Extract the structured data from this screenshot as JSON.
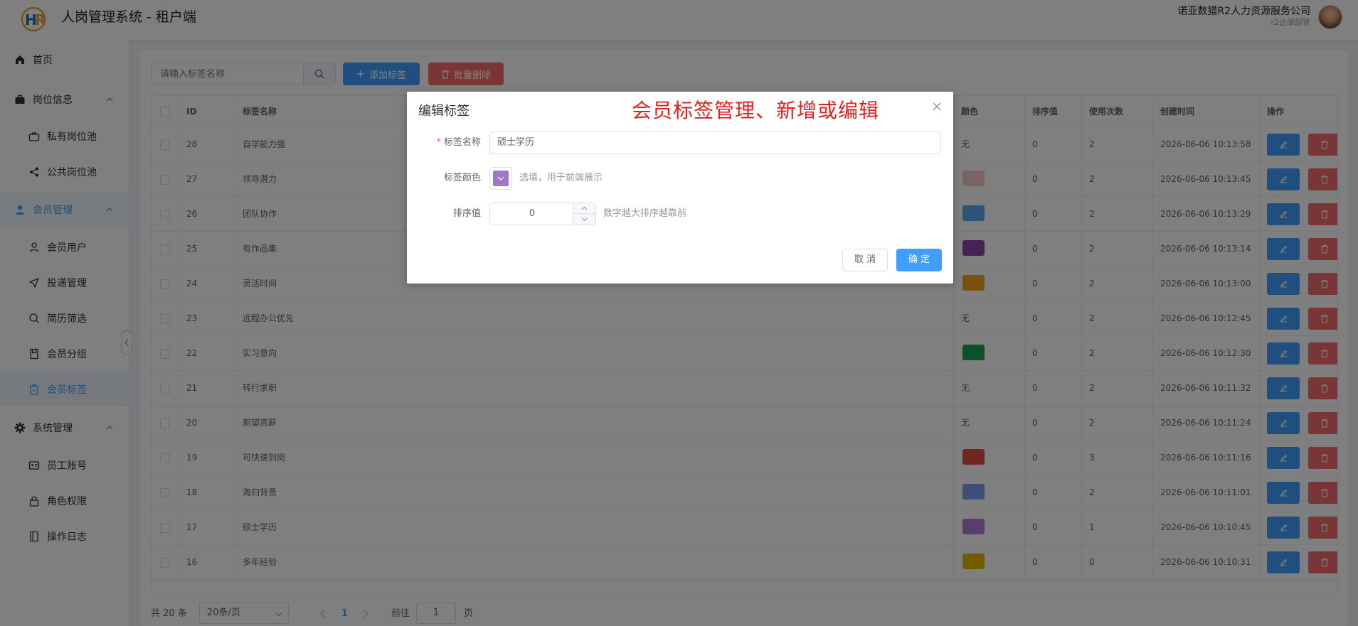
{
  "app": {
    "title": "人岗管理系统 - 租户端",
    "logo_text": "HR",
    "company": "诺亚数猎R2人力资源服务公司",
    "role": "r2达摩超管"
  },
  "sidebar": {
    "items": [
      {
        "label": "首页",
        "icon": "home-icon"
      },
      {
        "label": "岗位信息",
        "icon": "briefcase-icon",
        "expandable": true
      },
      {
        "label": "私有岗位池",
        "icon": "briefcase-outline-icon"
      },
      {
        "label": "公共岗位池",
        "icon": "share-icon"
      },
      {
        "label": "会员管理",
        "icon": "user-icon",
        "expandable": true
      },
      {
        "label": "会员用户",
        "icon": "person-outline-icon"
      },
      {
        "label": "投递管理",
        "icon": "send-icon"
      },
      {
        "label": "简历筛选",
        "icon": "search-icon"
      },
      {
        "label": "会员分组",
        "icon": "group-icon"
      },
      {
        "label": "会员标签",
        "icon": "tag-icon",
        "active": true
      },
      {
        "label": "系统管理",
        "icon": "gear-icon",
        "expandable": true
      },
      {
        "label": "员工账号",
        "icon": "id-card-icon"
      },
      {
        "label": "角色权限",
        "icon": "lock-icon"
      },
      {
        "label": "操作日志",
        "icon": "log-icon"
      }
    ]
  },
  "toolbar": {
    "search_placeholder": "请输入标签名称",
    "add_label": "添加标签",
    "batch_delete_label": "批量删除"
  },
  "table": {
    "headers": {
      "id": "ID",
      "name": "标签名称",
      "color": "颜色",
      "sort": "排序值",
      "usage": "使用次数",
      "created": "创建时间",
      "ops": "操作"
    },
    "rows": [
      {
        "id": "28",
        "name": "自学能力强",
        "color": null,
        "color_text": "无",
        "sort": "0",
        "usage": "2",
        "created": "2026-06-06 10:13:58"
      },
      {
        "id": "27",
        "name": "领导潜力",
        "color": "#f2c6c6",
        "color_text": "",
        "sort": "0",
        "usage": "2",
        "created": "2026-06-06 10:13:45"
      },
      {
        "id": "26",
        "name": "团队协作",
        "color": "#5aa8f0",
        "color_text": "",
        "sort": "0",
        "usage": "2",
        "created": "2026-06-06 10:13:29"
      },
      {
        "id": "25",
        "name": "有作品集",
        "color": "#8e44ad",
        "color_text": "",
        "sort": "0",
        "usage": "2",
        "created": "2026-06-06 10:13:14"
      },
      {
        "id": "24",
        "name": "灵活时间",
        "color": "#f0a020",
        "color_text": "",
        "sort": "0",
        "usage": "2",
        "created": "2026-06-06 10:13:00"
      },
      {
        "id": "23",
        "name": "远程办公优先",
        "color": null,
        "color_text": "无",
        "sort": "0",
        "usage": "2",
        "created": "2026-06-06 10:12:45"
      },
      {
        "id": "22",
        "name": "实习意向",
        "color": "#1e9e58",
        "color_text": "",
        "sort": "0",
        "usage": "2",
        "created": "2026-06-06 10:12:30"
      },
      {
        "id": "21",
        "name": "转行求职",
        "color": null,
        "color_text": "无",
        "sort": "0",
        "usage": "2",
        "created": "2026-06-06 10:11:32"
      },
      {
        "id": "20",
        "name": "期望高薪",
        "color": null,
        "color_text": "无",
        "sort": "0",
        "usage": "2",
        "created": "2026-06-06 10:11:24"
      },
      {
        "id": "19",
        "name": "可快速到岗",
        "color": "#e74c3c",
        "color_text": "",
        "sort": "0",
        "usage": "3",
        "created": "2026-06-06 10:11:16"
      },
      {
        "id": "18",
        "name": "海归背景",
        "color": "#7d9de8",
        "color_text": "",
        "sort": "0",
        "usage": "2",
        "created": "2026-06-06 10:11:01"
      },
      {
        "id": "17",
        "name": "硕士学历",
        "color": "#b07fd6",
        "color_text": "",
        "sort": "0",
        "usage": "1",
        "created": "2026-06-06 10:10:45"
      },
      {
        "id": "16",
        "name": "多年经验",
        "color": "#e6b800",
        "color_text": "",
        "sort": "0",
        "usage": "0",
        "created": "2026-06-06 10:10:31"
      }
    ]
  },
  "pagination": {
    "total": "共 20 条",
    "page_size": "20条/页",
    "current": "1",
    "goto_label": "前往",
    "goto_value": "1",
    "page_unit": "页"
  },
  "dialog": {
    "title": "编辑标签",
    "annotation": "会员标签管理、新增或编辑",
    "name_label": "标签名称",
    "name_value": "硕士学历",
    "color_label": "标签颜色",
    "color_value": "#a277c6",
    "color_hint": "选填，用于前端展示",
    "sort_label": "排序值",
    "sort_value": "0",
    "sort_hint": "数字越大排序越靠前",
    "cancel_label": "取 消",
    "ok_label": "确 定"
  }
}
